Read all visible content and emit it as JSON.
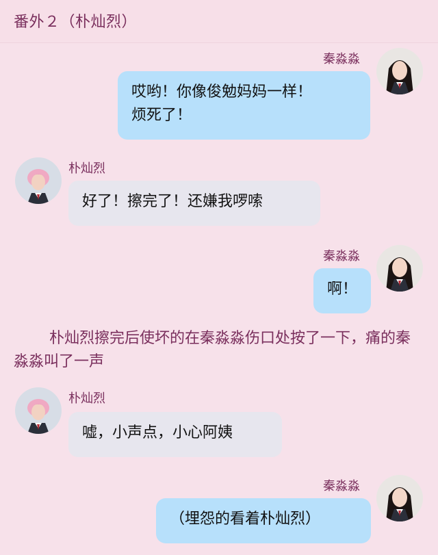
{
  "header": {
    "title": "番外２（朴灿烈）"
  },
  "messages": [
    {
      "side": "right",
      "sender": "秦淼淼",
      "text_lines": [
        "哎哟！你像俊勉妈妈一样！",
        "烦死了！"
      ]
    },
    {
      "side": "left",
      "sender": "朴灿烈",
      "text": "好了！擦完了！还嫌我啰嗦"
    },
    {
      "side": "right",
      "sender": "秦淼淼",
      "text": "啊！"
    },
    {
      "narration": "朴灿烈擦完后使坏的在秦淼淼伤口处按了一下，痛的秦淼淼叫了一声"
    },
    {
      "side": "left",
      "sender": "朴灿烈",
      "text": "嘘，小声点，小心阿姨"
    },
    {
      "side": "right",
      "sender": "秦淼淼",
      "text": "（埋怨的看着朴灿烈）"
    }
  ],
  "avatars": {
    "qin": {
      "icon": "girl-avatar-icon"
    },
    "park": {
      "icon": "boy-pink-hair-avatar-icon"
    }
  },
  "colors": {
    "background": "#f7e1ea",
    "accent_text": "#7a2f5d",
    "right_bubble": "#b7e0fb",
    "left_bubble": "#e7e6ee"
  }
}
